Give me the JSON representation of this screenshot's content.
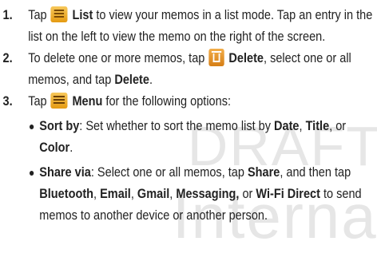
{
  "watermark": {
    "line1": "DRAFT",
    "line2": "Internal"
  },
  "steps": [
    {
      "num": "1.",
      "pre": "Tap",
      "icon": "list-icon",
      "bold1": "List",
      "rest": " to view your memos in a list mode. Tap an entry in the list on the left to view the memo on the right of the screen."
    },
    {
      "num": "2.",
      "pre": "To delete one or more memos, tap",
      "icon": "delete-icon",
      "bold1": "Delete",
      "mid": ", select one or all memos, and tap ",
      "bold2": "Delete",
      "end": "."
    },
    {
      "num": "3.",
      "pre": "Tap",
      "icon": "menu-icon",
      "bold1": "Menu",
      "rest": " for the following options:"
    }
  ],
  "bullets": [
    {
      "label": "Sort by",
      "t1": ": Set whether to sort the memo list by ",
      "o1": "Date",
      "t2": ", ",
      "o2": "Title",
      "t3": ", or ",
      "o3": "Color",
      "t4": "."
    },
    {
      "label": "Share via",
      "t1": ": Select one or all memos, tap ",
      "share": "Share",
      "t2": ", and then tap ",
      "bt": "Bluetooth",
      "c1": ", ",
      "email": "Email",
      "c2": ", ",
      "gmail": "Gmail",
      "c3": ", ",
      "msg": "Messaging,",
      "c4": " or ",
      "wifi": "Wi-Fi Direct",
      "t3": " to send memos to another device or another person."
    }
  ]
}
